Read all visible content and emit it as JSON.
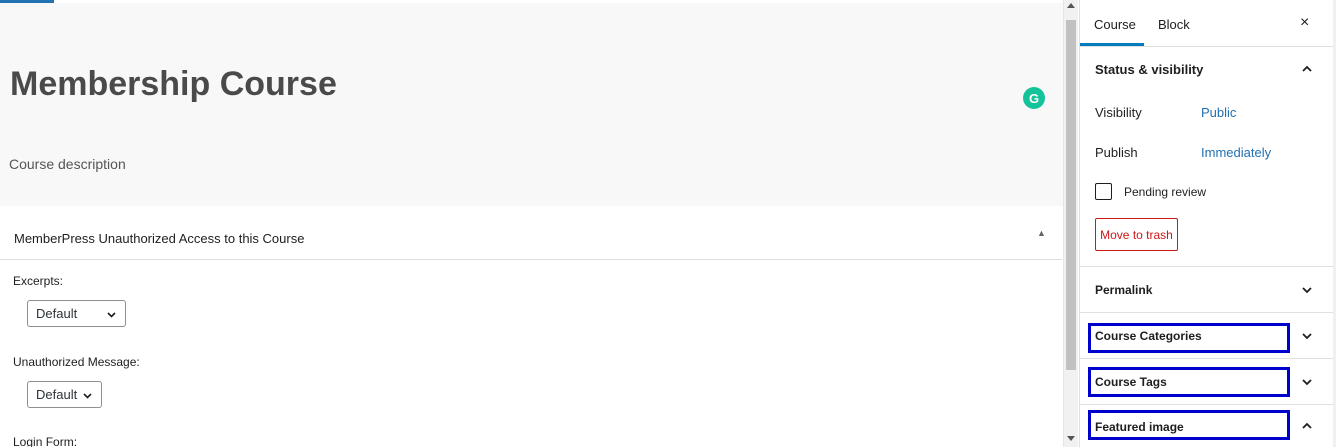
{
  "editor": {
    "title": "Membership Course",
    "description_placeholder": "Course description",
    "grammarly_letter": "G",
    "metabox": {
      "title": "MemberPress Unauthorized Access to this Course",
      "toggle_icon": "triangle-up-icon",
      "fields": [
        {
          "label": "Excerpts:",
          "value": "Default"
        },
        {
          "label": "Unauthorized Message:",
          "value": "Default"
        },
        {
          "label": "Login Form:"
        }
      ]
    }
  },
  "sidebar": {
    "tabs": [
      {
        "label": "Course",
        "active": true
      },
      {
        "label": "Block",
        "active": false
      }
    ],
    "close_label": "×",
    "status_visibility": {
      "title": "Status & visibility",
      "visibility_label": "Visibility",
      "visibility_value": "Public",
      "publish_label": "Publish",
      "publish_value": "Immediately",
      "pending_review_label": "Pending review",
      "pending_review_checked": false,
      "trash_label": "Move to trash"
    },
    "panels": [
      {
        "title": "Permalink",
        "expanded": false
      },
      {
        "title": "Course Categories",
        "expanded": false,
        "highlighted": true
      },
      {
        "title": "Course Tags",
        "expanded": false,
        "highlighted": true
      },
      {
        "title": "Featured image",
        "expanded": true,
        "highlighted": true
      }
    ]
  },
  "colors": {
    "accent": "#007cba",
    "link": "#2271b1",
    "danger": "#cc1818",
    "highlight_box": "#0000cc",
    "grammarly": "#15c39a"
  }
}
